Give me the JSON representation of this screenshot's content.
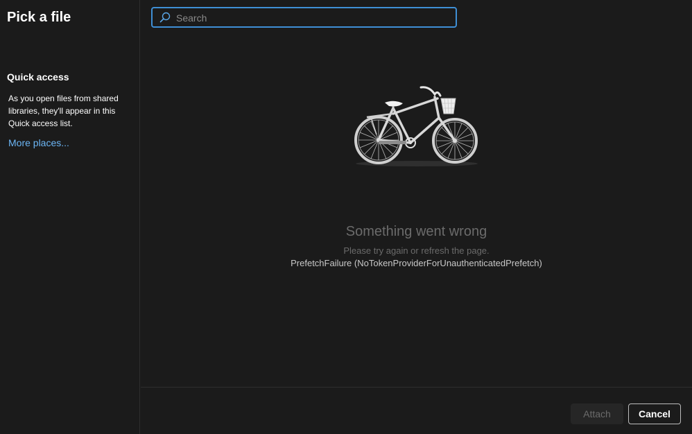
{
  "sidebar": {
    "title": "Pick a file",
    "quick_access": {
      "heading": "Quick access",
      "description": "As you open files from shared libraries, they'll appear in this Quick access list.",
      "more_link": "More places..."
    }
  },
  "search": {
    "placeholder": "Search",
    "value": ""
  },
  "error": {
    "title": "Something went wrong",
    "subtitle": "Please try again or refresh the page.",
    "code": "PrefetchFailure (NoTokenProviderForUnauthenticatedPrefetch)"
  },
  "footer": {
    "attach_label": "Attach",
    "cancel_label": "Cancel"
  },
  "icons": {
    "search": "search-icon",
    "illustration": "bicycle-illustration"
  },
  "colors": {
    "background": "#1b1b1b",
    "accent": "#3f8fd6",
    "link": "#6cb6f5",
    "muted_text": "#6b6b6b"
  }
}
